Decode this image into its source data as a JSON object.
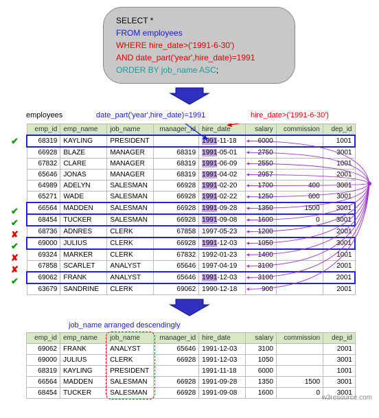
{
  "sql": {
    "select": "SELECT *",
    "from": "FROM employees",
    "where": "WHERE hire_date>('1991-6-30')",
    "and": "AND date_part('year',hire_date)=1991",
    "order": "ORDER BY job_name ASC",
    "semi": ";"
  },
  "labels": {
    "employees": "employees",
    "datepart": "date_part('year',hire_date)=1991",
    "hirecond": "hire_date>('1991-6-30')",
    "sortcaption": "job_name arranged descendingly"
  },
  "columns": [
    "emp_id",
    "emp_name",
    "job_name",
    "manager_id",
    "hire_date",
    "salary",
    "commission",
    "dep_id"
  ],
  "rows": [
    {
      "mark": "v",
      "sel": true,
      "emp_id": "68319",
      "emp_name": "KAYLING",
      "job_name": "PRESIDENT",
      "manager_id": "",
      "hire_date": "1991-11-18",
      "salary": "6000",
      "commission": "",
      "dep_id": "1001",
      "hl": true
    },
    {
      "mark": "",
      "sel": false,
      "emp_id": "66928",
      "emp_name": "BLAZE",
      "job_name": "MANAGER",
      "manager_id": "68319",
      "hire_date": "1991-05-01",
      "salary": "2750",
      "commission": "",
      "dep_id": "3001",
      "hl": true
    },
    {
      "mark": "",
      "sel": false,
      "emp_id": "67832",
      "emp_name": "CLARE",
      "job_name": "MANAGER",
      "manager_id": "68319",
      "hire_date": "1991-06-09",
      "salary": "2550",
      "commission": "",
      "dep_id": "1001",
      "hl": true
    },
    {
      "mark": "",
      "sel": false,
      "emp_id": "65646",
      "emp_name": "JONAS",
      "job_name": "MANAGER",
      "manager_id": "68319",
      "hire_date": "1991-04-02",
      "salary": "2957",
      "commission": "",
      "dep_id": "2001",
      "hl": true
    },
    {
      "mark": "",
      "sel": false,
      "emp_id": "64989",
      "emp_name": "ADELYN",
      "job_name": "SALESMAN",
      "manager_id": "66928",
      "hire_date": "1991-02-20",
      "salary": "1700",
      "commission": "400",
      "dep_id": "3001",
      "hl": true
    },
    {
      "mark": "",
      "sel": false,
      "emp_id": "65271",
      "emp_name": "WADE",
      "job_name": "SALESMAN",
      "manager_id": "66928",
      "hire_date": "1991-02-22",
      "salary": "1250",
      "commission": "600",
      "dep_id": "3001",
      "hl": true
    },
    {
      "mark": "v",
      "sel": true,
      "emp_id": "66564",
      "emp_name": "MADDEN",
      "job_name": "SALESMAN",
      "manager_id": "66928",
      "hire_date": "1991-09-28",
      "salary": "1350",
      "commission": "1500",
      "dep_id": "3001",
      "hl": true
    },
    {
      "mark": "v",
      "sel": true,
      "emp_id": "68454",
      "emp_name": "TUCKER",
      "job_name": "SALESMAN",
      "manager_id": "66928",
      "hire_date": "1991-09-08",
      "salary": "1600",
      "commission": "0",
      "dep_id": "3001",
      "hl": true
    },
    {
      "mark": "x",
      "sel": false,
      "emp_id": "68736",
      "emp_name": "ADNRES",
      "job_name": "CLERK",
      "manager_id": "67858",
      "hire_date": "1997-05-23",
      "salary": "1200",
      "commission": "",
      "dep_id": "2001",
      "hl": false
    },
    {
      "mark": "v",
      "sel": true,
      "emp_id": "69000",
      "emp_name": "JULIUS",
      "job_name": "CLERK",
      "manager_id": "66928",
      "hire_date": "1991-12-03",
      "salary": "1050",
      "commission": "",
      "dep_id": "3001",
      "hl": true
    },
    {
      "mark": "x",
      "sel": false,
      "emp_id": "69324",
      "emp_name": "MARKER",
      "job_name": "CLERK",
      "manager_id": "67832",
      "hire_date": "1992-01-23",
      "salary": "1400",
      "commission": "",
      "dep_id": "1001",
      "hl": false
    },
    {
      "mark": "x",
      "sel": false,
      "emp_id": "67858",
      "emp_name": "SCARLET",
      "job_name": "ANALYST",
      "manager_id": "65646",
      "hire_date": "1997-04-19",
      "salary": "3100",
      "commission": "",
      "dep_id": "2001",
      "hl": false
    },
    {
      "mark": "v",
      "sel": true,
      "emp_id": "69062",
      "emp_name": "FRANK",
      "job_name": "ANALYST",
      "manager_id": "65646",
      "hire_date": "1991-12-03",
      "salary": "3100",
      "commission": "",
      "dep_id": "2001",
      "hl": true
    },
    {
      "mark": "",
      "sel": false,
      "emp_id": "63679",
      "emp_name": "SANDRINE",
      "job_name": "CLERK",
      "manager_id": "69062",
      "hire_date": "1990-12-18",
      "salary": "900",
      "commission": "",
      "dep_id": "2001",
      "hl": false
    }
  ],
  "result_rows": [
    {
      "emp_id": "69062",
      "emp_name": "FRANK",
      "job_name": "ANALYST",
      "manager_id": "65646",
      "hire_date": "1991-12-03",
      "salary": "3100",
      "commission": "",
      "dep_id": "2001"
    },
    {
      "emp_id": "69000",
      "emp_name": "JULIUS",
      "job_name": "CLERK",
      "manager_id": "66928",
      "hire_date": "1991-12-03",
      "salary": "1050",
      "commission": "",
      "dep_id": "3001"
    },
    {
      "emp_id": "68319",
      "emp_name": "KAYLING",
      "job_name": "PRESIDENT",
      "manager_id": "",
      "hire_date": "1991-11-18",
      "salary": "6000",
      "commission": "",
      "dep_id": "1001"
    },
    {
      "emp_id": "66564",
      "emp_name": "MADDEN",
      "job_name": "SALESMAN",
      "manager_id": "66928",
      "hire_date": "1991-09-28",
      "salary": "1350",
      "commission": "1500",
      "dep_id": "3001"
    },
    {
      "emp_id": "68454",
      "emp_name": "TUCKER",
      "job_name": "SALESMAN",
      "manager_id": "66928",
      "hire_date": "1991-09-08",
      "salary": "1600",
      "commission": "0",
      "dep_id": "3001"
    }
  ],
  "credit": "w3resource.com"
}
